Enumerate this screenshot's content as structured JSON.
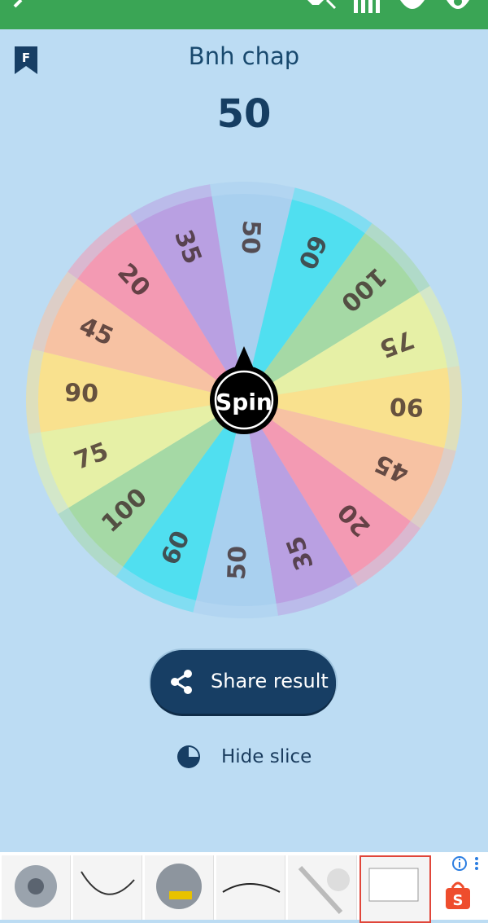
{
  "header": {
    "title": "Bnh chap",
    "result": "50"
  },
  "wheel": {
    "center_label": "Spin",
    "slices": [
      {
        "label": "50",
        "color": "#a9d0ef"
      },
      {
        "label": "60",
        "color": "#50dff0"
      },
      {
        "label": "100",
        "color": "#a5d9a5"
      },
      {
        "label": "75",
        "color": "#e6f0a6"
      },
      {
        "label": "90",
        "color": "#f9e18e"
      },
      {
        "label": "45",
        "color": "#f7c2a3"
      },
      {
        "label": "20",
        "color": "#f39ab3"
      },
      {
        "label": "35",
        "color": "#b9a0e2"
      },
      {
        "label": "50",
        "color": "#a9d0ef"
      },
      {
        "label": "60",
        "color": "#50dff0"
      },
      {
        "label": "100",
        "color": "#a5d9a5"
      },
      {
        "label": "75",
        "color": "#e6f0a6"
      },
      {
        "label": "90",
        "color": "#f9e18e"
      },
      {
        "label": "45",
        "color": "#f7c2a3"
      },
      {
        "label": "20",
        "color": "#f39ab3"
      },
      {
        "label": "35",
        "color": "#b9a0e2"
      }
    ]
  },
  "actions": {
    "share_label": "Share result",
    "hide_label": "Hide slice"
  },
  "colors": {
    "background": "#bcdcf3",
    "topbar": "#3aa555",
    "primary": "#173e64"
  },
  "icons": {
    "toolbar": [
      "back-icon",
      "mute-icon",
      "list-icon",
      "theme-icon",
      "settings-icon"
    ],
    "flag": "bookmark-icon",
    "share": "share-icon",
    "hide": "pie-icon"
  }
}
